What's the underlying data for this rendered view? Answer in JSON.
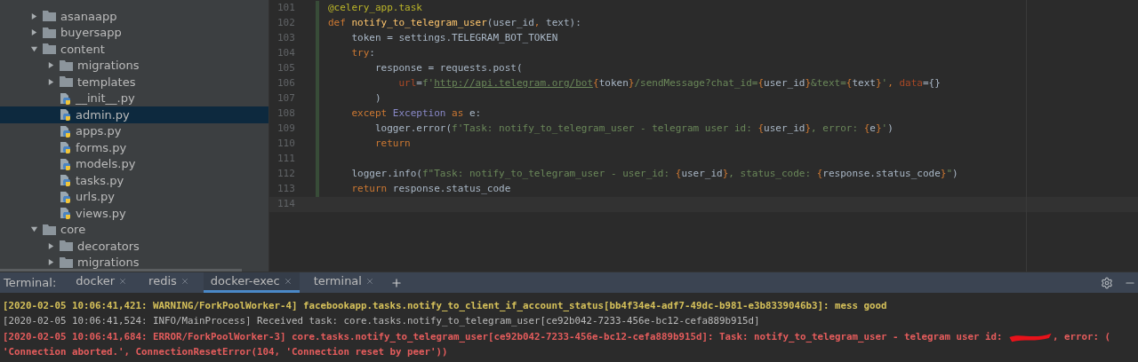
{
  "project_tree": [
    {
      "label": "asanaapp",
      "kind": "folder",
      "expanded": false,
      "selected": false
    },
    {
      "label": "buyersapp",
      "kind": "folder",
      "expanded": false,
      "selected": false
    },
    {
      "label": "content",
      "kind": "folder",
      "expanded": true,
      "selected": false,
      "children": [
        {
          "label": "migrations",
          "kind": "folder",
          "expanded": false,
          "selected": false
        },
        {
          "label": "templates",
          "kind": "folder",
          "expanded": false,
          "selected": false
        },
        {
          "label": "__init__.py",
          "kind": "python",
          "selected": false
        },
        {
          "label": "admin.py",
          "kind": "python",
          "selected": true
        },
        {
          "label": "apps.py",
          "kind": "python",
          "selected": false
        },
        {
          "label": "forms.py",
          "kind": "python",
          "selected": false
        },
        {
          "label": "models.py",
          "kind": "python",
          "selected": false
        },
        {
          "label": "tasks.py",
          "kind": "python",
          "selected": false
        },
        {
          "label": "urls.py",
          "kind": "python",
          "selected": false
        },
        {
          "label": "views.py",
          "kind": "python",
          "selected": false
        }
      ]
    },
    {
      "label": "core",
      "kind": "folder",
      "expanded": true,
      "selected": false,
      "children": [
        {
          "label": "decorators",
          "kind": "folder",
          "expanded": false,
          "selected": false
        },
        {
          "label": "migrations",
          "kind": "folder",
          "expanded": false,
          "selected": false
        }
      ]
    }
  ],
  "editor": {
    "lines": [
      {
        "number": "101",
        "current": false,
        "tokens": [
          {
            "t": "@celery_app.task",
            "kind": "decorator"
          }
        ]
      },
      {
        "number": "102",
        "current": false,
        "tokens": [
          {
            "t": "def ",
            "kind": "keyword"
          },
          {
            "t": "notify_to_telegram_user",
            "kind": "func"
          },
          {
            "t": "(user_id",
            "kind": "plain"
          },
          {
            "t": ", ",
            "kind": "keyword"
          },
          {
            "t": "text):",
            "kind": "plain"
          }
        ]
      },
      {
        "number": "103",
        "current": false,
        "tokens": [
          {
            "t": "    token = settings.TELEGRAM_BOT_TOKEN",
            "kind": "plain"
          }
        ]
      },
      {
        "number": "104",
        "current": false,
        "tokens": [
          {
            "t": "    try",
            "kind": "keyword"
          },
          {
            "t": ":",
            "kind": "plain"
          }
        ]
      },
      {
        "number": "105",
        "current": false,
        "tokens": [
          {
            "t": "        response = requests.post(",
            "kind": "plain"
          }
        ]
      },
      {
        "number": "106",
        "current": false,
        "tokens": [
          {
            "t": "            url",
            "kind": "param"
          },
          {
            "t": "=",
            "kind": "plain"
          },
          {
            "t": "f'",
            "kind": "string"
          },
          {
            "t": "http://api.telegram.org/bot",
            "kind": "link"
          },
          {
            "t": "{",
            "kind": "brace"
          },
          {
            "t": "token",
            "kind": "plain"
          },
          {
            "t": "}",
            "kind": "brace"
          },
          {
            "t": "/sendMessage?chat_id=",
            "kind": "string"
          },
          {
            "t": "{",
            "kind": "brace"
          },
          {
            "t": "user_id",
            "kind": "plain"
          },
          {
            "t": "}",
            "kind": "brace"
          },
          {
            "t": "&text=",
            "kind": "string"
          },
          {
            "t": "{",
            "kind": "brace"
          },
          {
            "t": "text",
            "kind": "plain"
          },
          {
            "t": "}",
            "kind": "brace"
          },
          {
            "t": "'",
            "kind": "string"
          },
          {
            "t": ", ",
            "kind": "keyword"
          },
          {
            "t": "data",
            "kind": "param"
          },
          {
            "t": "={}",
            "kind": "plain"
          }
        ]
      },
      {
        "number": "107",
        "current": false,
        "tokens": [
          {
            "t": "        )",
            "kind": "plain"
          }
        ]
      },
      {
        "number": "108",
        "current": false,
        "tokens": [
          {
            "t": "    except ",
            "kind": "keyword"
          },
          {
            "t": "Exception ",
            "kind": "builtin"
          },
          {
            "t": "as ",
            "kind": "keyword"
          },
          {
            "t": "e:",
            "kind": "plain"
          }
        ]
      },
      {
        "number": "109",
        "current": false,
        "tokens": [
          {
            "t": "        logger.error(",
            "kind": "plain"
          },
          {
            "t": "f'Task: notify_to_telegram_user - telegram user id: ",
            "kind": "string"
          },
          {
            "t": "{",
            "kind": "brace"
          },
          {
            "t": "user_id",
            "kind": "plain"
          },
          {
            "t": "}",
            "kind": "brace"
          },
          {
            "t": ", error: ",
            "kind": "string"
          },
          {
            "t": "{",
            "kind": "brace"
          },
          {
            "t": "e",
            "kind": "plain"
          },
          {
            "t": "}",
            "kind": "brace"
          },
          {
            "t": "'",
            "kind": "string"
          },
          {
            "t": ")",
            "kind": "plain"
          }
        ]
      },
      {
        "number": "110",
        "current": false,
        "tokens": [
          {
            "t": "        return",
            "kind": "keyword"
          }
        ]
      },
      {
        "number": "111",
        "current": false
      },
      {
        "number": "112",
        "current": false,
        "tokens": [
          {
            "t": "    logger.info(",
            "kind": "plain"
          },
          {
            "t": "f\"Task: notify_to_telegram_user - user_id: ",
            "kind": "string"
          },
          {
            "t": "{",
            "kind": "brace"
          },
          {
            "t": "user_id",
            "kind": "plain"
          },
          {
            "t": "}",
            "kind": "brace"
          },
          {
            "t": ", status_code: ",
            "kind": "string"
          },
          {
            "t": "{",
            "kind": "brace"
          },
          {
            "t": "response.status_code",
            "kind": "plain"
          },
          {
            "t": "}",
            "kind": "brace"
          },
          {
            "t": "\"",
            "kind": "string"
          },
          {
            "t": ")",
            "kind": "plain"
          }
        ]
      },
      {
        "number": "113",
        "current": false,
        "tokens": [
          {
            "t": "    return ",
            "kind": "keyword"
          },
          {
            "t": "response.status_code",
            "kind": "plain"
          }
        ]
      },
      {
        "number": "114",
        "current": true
      }
    ]
  },
  "terminal": {
    "label": "Terminal:",
    "tabs": [
      {
        "label": "docker",
        "selected": false
      },
      {
        "label": "redis",
        "selected": false
      },
      {
        "label": "docker-exec",
        "selected": true
      },
      {
        "label": "terminal",
        "selected": false
      }
    ],
    "lines": [
      {
        "kind": "warning",
        "text": "[2020-02-05 10:06:41,421: WARNING/ForkPoolWorker-4] facebookapp.tasks.notify_to_client_if_account_status[bb4f34e4-adf7-49dc-b981-e3b8339046b3]: mess good"
      },
      {
        "kind": "info",
        "text": "[2020-02-05 10:06:41,524: INFO/MainProcess] Received task: core.tasks.notify_to_telegram_user[ce92b042-7233-456e-bc12-cefa889b915d]"
      },
      {
        "kind": "error",
        "text": "[2020-02-05 10:06:41,684: ERROR/ForkPoolWorker-3] core.tasks.notify_to_telegram_user[ce92b042-7233-456e-bc12-cefa889b915d]: Task: notify_to_telegram_user - telegram user id: ",
        "redacted": true,
        "after": ", error: ("
      },
      {
        "kind": "error",
        "text": "'Connection aborted.', ConnectionResetError(104, 'Connection reset by peer'))"
      }
    ]
  }
}
